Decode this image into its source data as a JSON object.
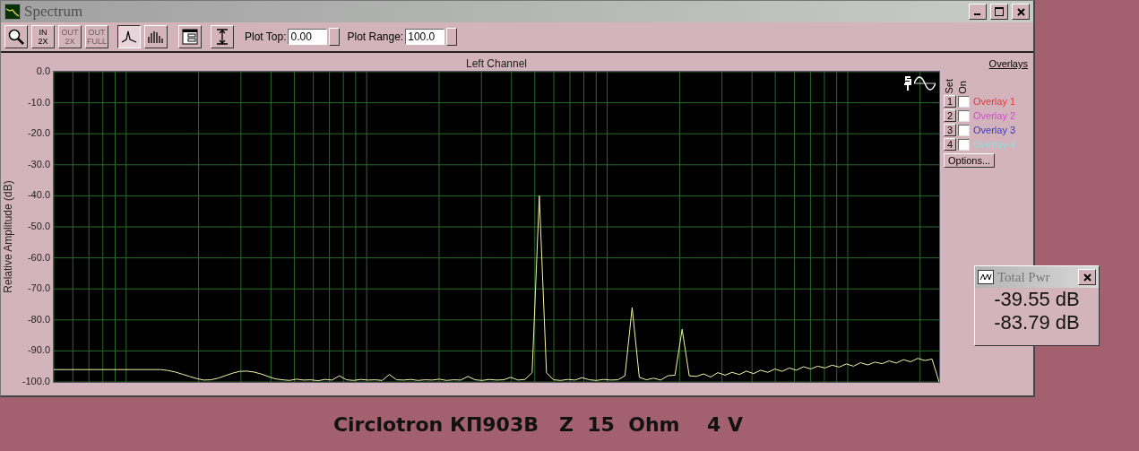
{
  "window": {
    "title": "Spectrum"
  },
  "toolbar": {
    "buttons": [
      {
        "kind": "zoom",
        "disabled": false
      },
      {
        "kind": "zoom-in",
        "top": "IN",
        "bottom": "2X",
        "disabled": false
      },
      {
        "kind": "zoom-out",
        "top": "OUT",
        "bottom": "2X",
        "disabled": true
      },
      {
        "kind": "zoom-out",
        "top": "OUT",
        "bottom": "FULL",
        "disabled": true
      }
    ],
    "plot_modes": [
      {
        "kind": "line",
        "pressed": true
      },
      {
        "kind": "bars",
        "pressed": false
      }
    ],
    "fields": [
      {
        "label": "Plot Top:",
        "value": "0.00"
      },
      {
        "label": "Plot Range:",
        "value": "100.0"
      }
    ]
  },
  "chart": {
    "chart_data": {
      "type": "line",
      "title": "Left Channel",
      "ylabel": "Relative Amplitude (dB)",
      "ylim": [
        -100,
        0
      ],
      "grid": true,
      "yticks": [
        {
          "value": 0,
          "label": "0.0"
        },
        {
          "value": -10,
          "label": "-10.0"
        },
        {
          "value": -20,
          "label": "-20.0"
        },
        {
          "value": -30,
          "label": "-30.0"
        },
        {
          "value": -40,
          "label": "-40.0"
        },
        {
          "value": -50,
          "label": "-50.0"
        },
        {
          "value": -60,
          "label": "-60.0"
        },
        {
          "value": -70,
          "label": "-70.0"
        },
        {
          "value": -80,
          "label": "-80.0"
        },
        {
          "value": -90,
          "label": "-90.0"
        },
        {
          "value": -100,
          "label": "-100.0"
        }
      ],
      "series": [
        {
          "color": "#f4f4a8",
          "values": [
            -96,
            -96,
            -96,
            -96,
            -96,
            -96,
            -96,
            -96,
            -96,
            -96,
            -96,
            -96,
            -96,
            -96,
            -96,
            -96,
            -96.3,
            -96.8,
            -97.5,
            -98.2,
            -98.9,
            -99.4,
            -99.3,
            -98.8,
            -98,
            -97.2,
            -96.6,
            -96.5,
            -96.8,
            -97.4,
            -98.2,
            -99,
            -99.3,
            -99.5,
            -99.1,
            -99.4,
            -99.3,
            -99.6,
            -99.2,
            -99.4,
            -98,
            -99.3,
            -99.5,
            -99.2,
            -99.4,
            -99.3,
            -99.5,
            -97.6,
            -99.3,
            -99.4,
            -99.2,
            -99.5,
            -99.3,
            -99.4,
            -99.1,
            -99.5,
            -99.3,
            -99.4,
            -98.2,
            -99.3,
            -99.5,
            -99.2,
            -99.4,
            -99.3,
            -98.5,
            -99.4,
            -99.2,
            -97,
            -40,
            -97,
            -99.3,
            -99.5,
            -99.2,
            -99.4,
            -98.6,
            -99.3,
            -99.5,
            -99.2,
            -99.4,
            -99.3,
            -98,
            -76,
            -98.5,
            -99.3,
            -98.8,
            -99.4,
            -98,
            -97.8,
            -83,
            -98,
            -98.2,
            -97.4,
            -98.4,
            -97,
            -97.8,
            -96.9,
            -97.6,
            -96.5,
            -97.3,
            -96.2,
            -96.9,
            -95.8,
            -96.6,
            -95.5,
            -96.2,
            -95.1,
            -95.8,
            -94.9,
            -95.5,
            -94.6,
            -95.2,
            -94.2,
            -94.9,
            -93.8,
            -94.5,
            -93.6,
            -94.1,
            -93.2,
            -93.9,
            -92.8,
            -93.5,
            -92.4,
            -93.1,
            -92.6,
            -100
          ]
        }
      ]
    }
  },
  "overlays": {
    "title": "Overlays",
    "headers": [
      "Set",
      "On"
    ],
    "items": [
      {
        "set": "1",
        "label": "Overlay 1",
        "color": "#e03a3a",
        "checked": false
      },
      {
        "set": "2",
        "label": "Overlay 2",
        "color": "#d448d4",
        "checked": false
      },
      {
        "set": "3",
        "label": "Overlay 3",
        "color": "#3838c8",
        "checked": false
      },
      {
        "set": "4",
        "label": "Overlay 4",
        "color": "#88e0e0",
        "checked": false
      }
    ],
    "button": "Options..."
  },
  "total_power": {
    "title": "Total Pwr",
    "readings": [
      "-39.55 dB",
      "-83.79 dB"
    ]
  },
  "caption": "Circlotron КП903В   Z  15  Ohm    4 V"
}
